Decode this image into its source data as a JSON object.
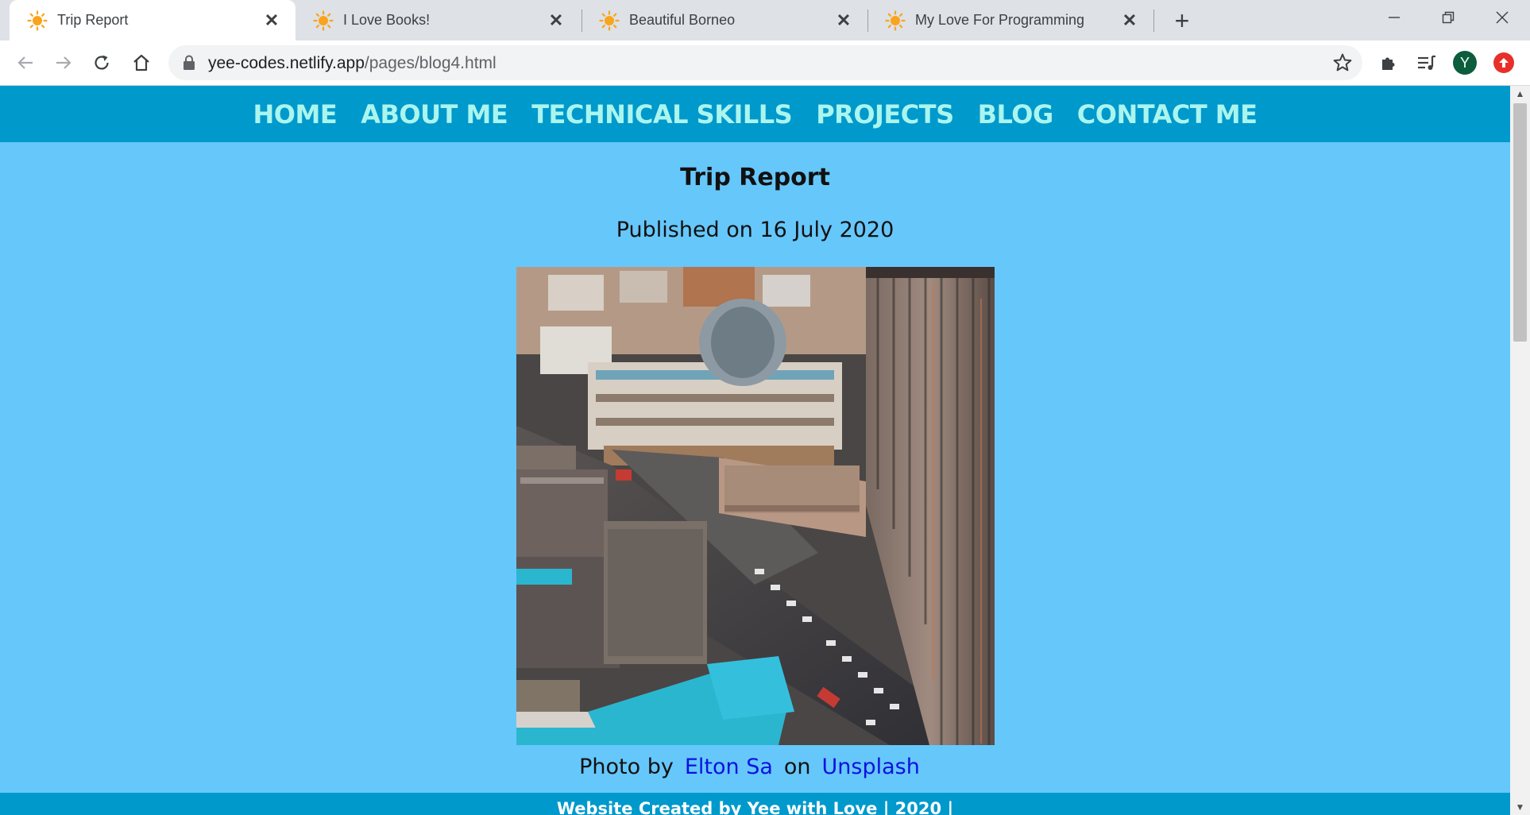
{
  "browser": {
    "tabs": [
      {
        "title": "Trip Report",
        "active": true
      },
      {
        "title": "I Love Books!",
        "active": false
      },
      {
        "title": "Beautiful Borneo",
        "active": false
      },
      {
        "title": "My Love For Programming",
        "active": false
      }
    ],
    "url": {
      "host": "yee-codes.netlify.app",
      "path": "/pages/blog4.html"
    },
    "profile_initial": "Y"
  },
  "site": {
    "nav": [
      "HOME",
      "ABOUT ME",
      "TECHNICAL SKILLS",
      "PROJECTS",
      "BLOG",
      "CONTACT ME"
    ],
    "title": "Trip Report",
    "published": "Published on 16 July 2020",
    "credit": {
      "prefix": "Photo by",
      "author": "Elton Sa",
      "middle": "on",
      "source": "Unsplash"
    },
    "footer": "Website Created by Yee with Love | 2020 |"
  },
  "colors": {
    "nav_bg": "#0099cc",
    "page_bg": "#66c7fb",
    "nav_text": "#aaf5ee",
    "link": "#0b12e0"
  }
}
